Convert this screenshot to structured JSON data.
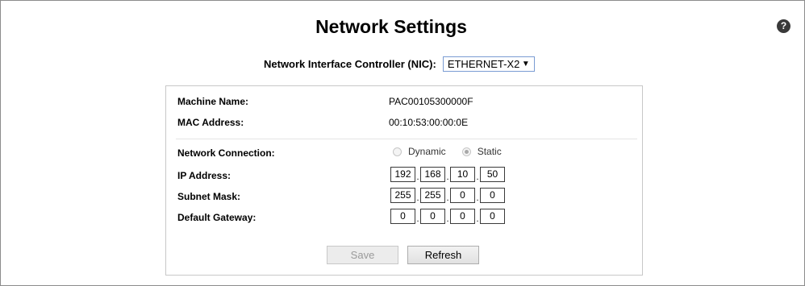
{
  "page": {
    "title": "Network Settings",
    "help_glyph": "?"
  },
  "nic": {
    "label": "Network Interface Controller (NIC):",
    "selected": "ETHERNET-X2",
    "arrow": "▼"
  },
  "info": {
    "machine_name_label": "Machine Name:",
    "machine_name_value": "PAC00105300000F",
    "mac_label": "MAC Address:",
    "mac_value": "00:10:53:00:00:0E"
  },
  "connection": {
    "label": "Network Connection:",
    "options": [
      {
        "label": "Dynamic",
        "checked": false
      },
      {
        "label": "Static",
        "checked": true
      }
    ]
  },
  "ip": {
    "label": "IP Address:",
    "octets": [
      "192",
      "168",
      "10",
      "50"
    ]
  },
  "subnet": {
    "label": "Subnet Mask:",
    "octets": [
      "255",
      "255",
      "0",
      "0"
    ]
  },
  "gateway": {
    "label": "Default Gateway:",
    "octets": [
      "0",
      "0",
      "0",
      "0"
    ]
  },
  "buttons": {
    "save": "Save",
    "refresh": "Refresh"
  },
  "icons": {
    "help": "help-icon",
    "dropdown": "chevron-down-icon"
  }
}
